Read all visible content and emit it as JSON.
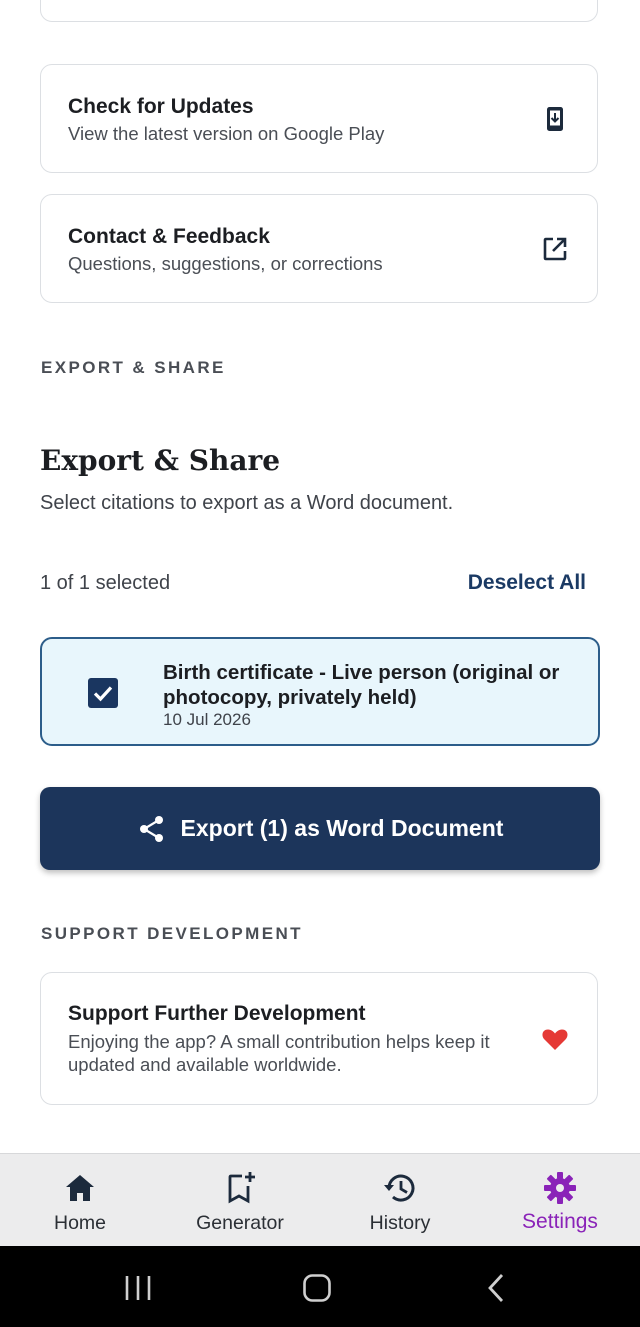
{
  "about_cards": [
    {
      "title": "Check for Updates",
      "subtitle": "View the latest version on Google Play",
      "icon": "download-phone-icon"
    },
    {
      "title": "Contact & Feedback",
      "subtitle": "Questions, suggestions, or corrections",
      "icon": "open-external-icon"
    }
  ],
  "export_section": {
    "label": "EXPORT & SHARE",
    "title": "Export & Share",
    "subtitle": "Select citations to export as a Word document.",
    "selected_count": "1 of 1 selected",
    "deselect_label": "Deselect All",
    "citations": [
      {
        "title": "Birth certificate - Live person (original or photocopy, privately held)",
        "date": "10 Jul 2026",
        "checked": true
      }
    ],
    "export_button": "Export (1) as Word Document"
  },
  "support_section": {
    "label": "SUPPORT DEVELOPMENT",
    "title": "Support Further Development",
    "subtitle": "Enjoying the app? A small contribution helps keep it updated and available worldwide.",
    "icon": "heart-icon"
  },
  "bottom_nav": {
    "items": [
      {
        "label": "Home",
        "icon": "home-icon"
      },
      {
        "label": "Generator",
        "icon": "bookmark-add-icon"
      },
      {
        "label": "History",
        "icon": "history-icon"
      },
      {
        "label": "Settings",
        "icon": "gear-icon",
        "active": true
      }
    ]
  },
  "colors": {
    "primary": "#1c355b",
    "active_nav": "#8a23b8",
    "heart": "#e53935",
    "selected_bg": "#e8f6fc"
  }
}
